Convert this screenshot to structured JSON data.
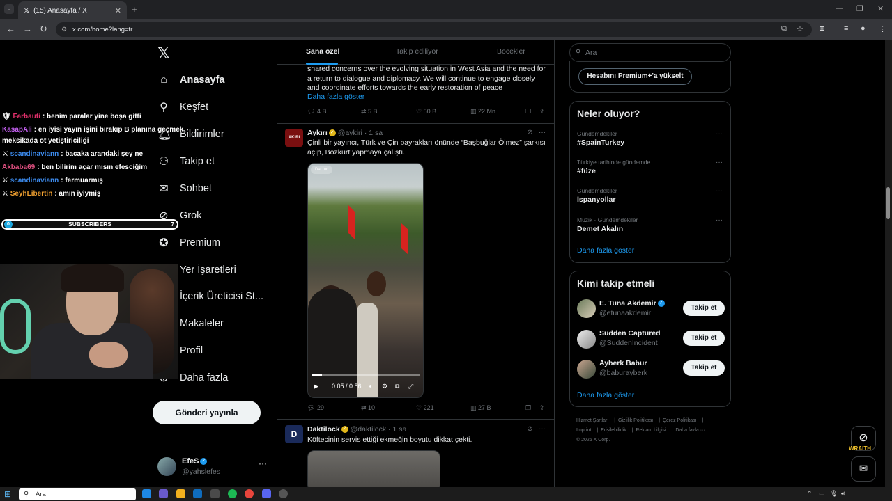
{
  "browser": {
    "tab_title": "(15) Anasayfa / X",
    "tab_close": "✕",
    "new_tab": "+",
    "url": "x.com/home?lang=tr"
  },
  "nav": {
    "items": [
      {
        "label": "Anasayfa",
        "icon": "home-icon"
      },
      {
        "label": "Keşfet",
        "icon": "search-icon"
      },
      {
        "label": "Bildirimler",
        "icon": "bell-icon"
      },
      {
        "label": "Takip et",
        "icon": "add-user-icon"
      },
      {
        "label": "Sohbet",
        "icon": "mail-icon"
      },
      {
        "label": "Grok",
        "icon": "grok-icon"
      },
      {
        "label": "Premium",
        "icon": "premium-icon"
      },
      {
        "label": "Yer İşaretleri",
        "icon": "bookmark-icon"
      },
      {
        "label": "İçerik Üreticisi St...",
        "icon": "studio-icon"
      },
      {
        "label": "Makaleler",
        "icon": "article-icon"
      },
      {
        "label": "Profil",
        "icon": "profile-icon"
      },
      {
        "label": "Daha fazla",
        "icon": "more-icon"
      }
    ],
    "post_button": "Gönderi yayınla",
    "account": {
      "name": "EfeS",
      "handle": "@yahslefes",
      "more": "···"
    }
  },
  "feed": {
    "tabs": [
      "Sana özel",
      "Takip ediliyor",
      "Böcekler"
    ],
    "tweet1": {
      "text": "shared concerns over the evolving situation in West Asia and the need for a return to dialogue and diplomacy. We will continue to engage closely and coordinate efforts towards the early restoration of peace",
      "show_more": "Daha fazla göster",
      "replies": "4 B",
      "reposts": "5 B",
      "likes": "50 B",
      "views": "22 Mn"
    },
    "tweet2": {
      "name": "Aykırı",
      "handle": "@aykiri",
      "time": "· 1 sa",
      "avatar_text": "AKIRI",
      "text": "Çinli bir yayıncı, Türk ve Çin bayrakları önünde “Başbuğlar Ölmez” şarkısı açıp, Bozkurt yapmaya çalıştı.",
      "video_time": "0:05 / 0:56",
      "video_progress": 0.09,
      "video_caption": "Dai run",
      "replies": "29",
      "reposts": "10",
      "likes": "221",
      "views": "27 B"
    },
    "tweet3": {
      "name": "Daktilock",
      "handle": "@daktilock",
      "time": "· 1 sa",
      "avatar_text": "D",
      "text": "Köftecinin servis ettiği ekmeğin boyutu dikkat çekti."
    }
  },
  "sidebar": {
    "search_placeholder": "Ara",
    "premium_button": "Hesabını Premium+'a yükselt",
    "trends_title": "Neler oluyor?",
    "trends": [
      {
        "category": "Gündemdekiler",
        "name": "#SpainTurkey"
      },
      {
        "category": "Türkiye tarihinde gündemde",
        "name": "#füze"
      },
      {
        "category": "Gündemdekiler",
        "name": "İspanyollar"
      },
      {
        "category": "Müzik · Gündemdekiler",
        "name": "Demet Akalın"
      }
    ],
    "trends_more": "Daha fazla göster",
    "who_title": "Kimi takip etmeli",
    "who": [
      {
        "name": "E. Tuna Akdemir",
        "handle": "@etunaakdemir",
        "button": "Takip et"
      },
      {
        "name": "Sudden Captured",
        "handle": "@SuddenIncident",
        "button": "Takip et"
      },
      {
        "name": "Ayberk Babur",
        "handle": "@baburayberk",
        "button": "Takip et"
      }
    ],
    "who_more": "Daha fazla göster",
    "footer": [
      "Hizmet Şartları",
      "Gizlilik Politikası",
      "Çerez Politikası",
      "Imprint",
      "Erişilebilirlik",
      "Reklam bilgisi",
      "Daha fazla ···",
      "© 2026 X Corp."
    ]
  },
  "overlay": {
    "chat": [
      {
        "user": "Farbauti",
        "msg": ": benim paralar yine boşa gitti",
        "color": "#e0306b"
      },
      {
        "user": "KasapAli",
        "msg": ": en iyisi yayın işini bırakıp B planına geçmek",
        "color": "#c460f0"
      },
      {
        "user": "",
        "msg": "meksikada ot yetiştiriciliği",
        "color": "#ffffff"
      },
      {
        "user": "scandinaviann",
        "msg": ": bacaka arandaki şey ne",
        "color": "#3c8cf0"
      },
      {
        "user": "Akbaba69",
        "msg": ": ben bilirim açar mısın efesciğim",
        "color": "#e05080"
      },
      {
        "user": "scandinaviann",
        "msg": ": fermuarmış",
        "color": "#3c8cf0"
      },
      {
        "user": "SeyhLibertin",
        "msg": ": amın iyiymiş",
        "color": "#f0a030"
      }
    ],
    "subs_label": "SUBSCRIBERS",
    "subs_start": "0",
    "subs_goal": "7",
    "wraith_label": "WRAITH"
  },
  "taskbar": {
    "search": "Ara"
  }
}
